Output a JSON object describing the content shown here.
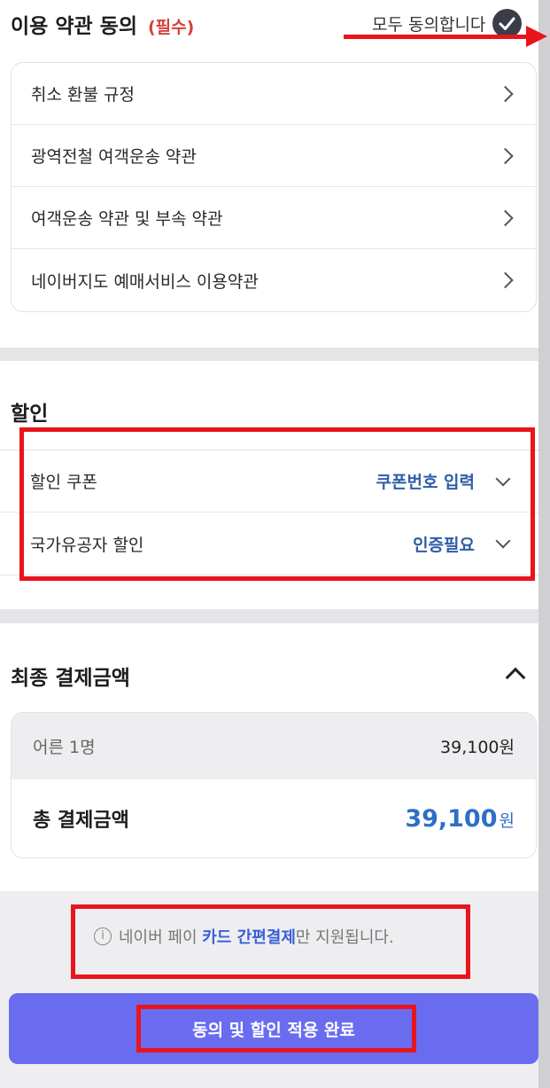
{
  "terms": {
    "title": "이용 약관 동의",
    "required_tag": "(필수)",
    "agree_all_label": "모두 동의합니다",
    "items": [
      {
        "label": "취소 환불 규정"
      },
      {
        "label": "광역전철 여객운송 약관"
      },
      {
        "label": "여객운송 약관 및 부속 약관"
      },
      {
        "label": "네이버지도 예매서비스 이용약관"
      }
    ]
  },
  "discount": {
    "title": "할인",
    "rows": [
      {
        "label": "할인 쿠폰",
        "value": "쿠폰번호 입력"
      },
      {
        "label": "국가유공자 할인",
        "value": "인증필요"
      }
    ]
  },
  "payment": {
    "title": "최종 결제금액",
    "adult_label": "어른 1명",
    "adult_amount": "39,100원",
    "total_label": "총 결제금액",
    "total_amount": "39,100",
    "total_unit": "원"
  },
  "notice": {
    "prefix": "네이버 페이 ",
    "highlight": "카드 간편결제",
    "suffix": "만 지원됩니다."
  },
  "submit_label": "동의 및 할인 적용 완료",
  "colors": {
    "accent_blue": "#2e5ea8",
    "total_blue": "#2f6fc4",
    "required_red": "#d5413b",
    "button": "#6a6cf0",
    "annotation_red": "#e8151b"
  }
}
